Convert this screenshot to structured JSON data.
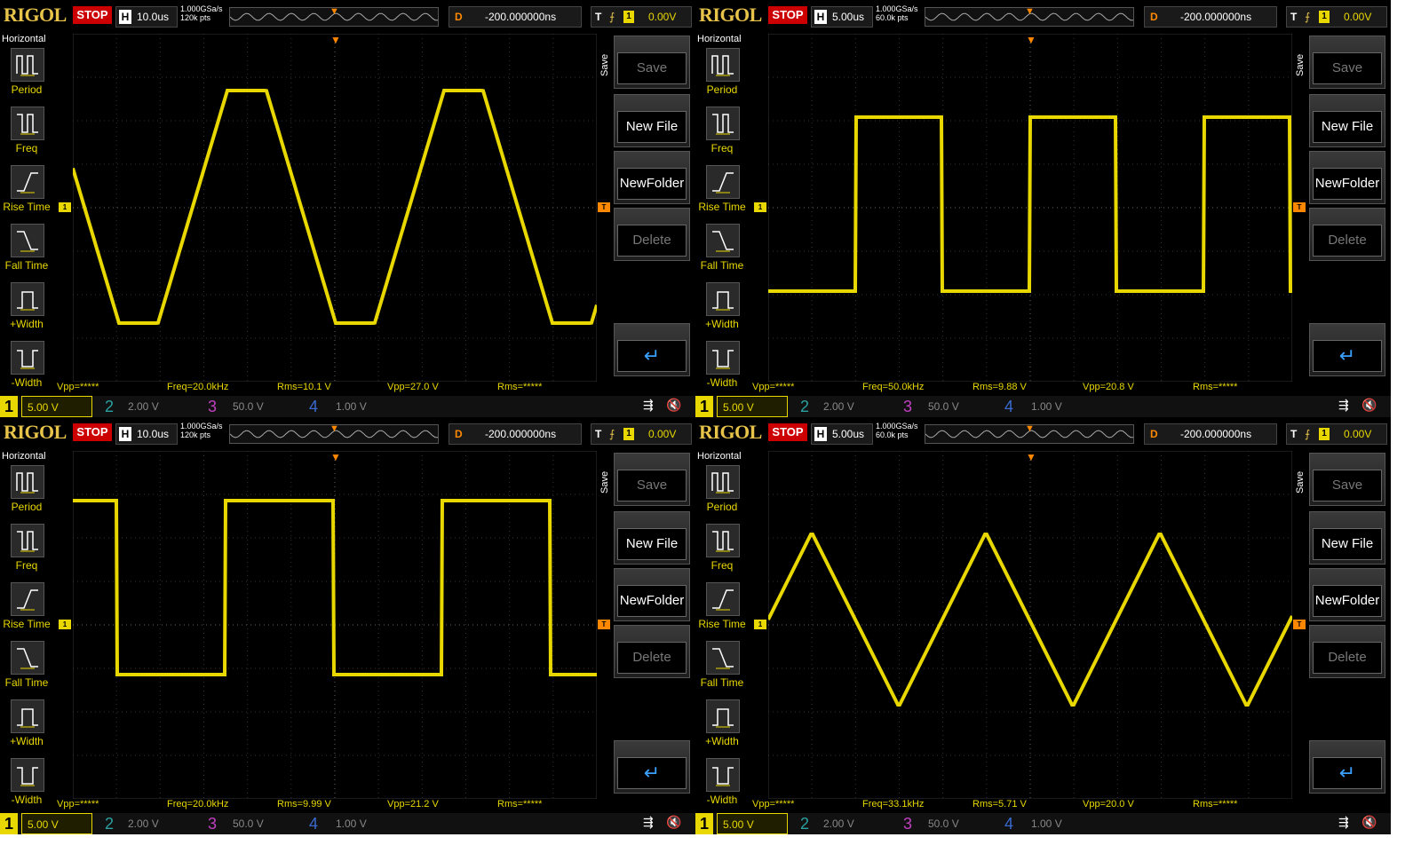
{
  "screens": [
    {
      "id": "top-left",
      "logo": "RIGOL",
      "stop": "STOP",
      "h_key": "H",
      "h_value": "10.0us",
      "sample_rate": "1.000GSa/s",
      "mem_depth": "120k pts",
      "d_key": "D",
      "d_value": "-200.000000ns",
      "t_key": "T",
      "trig_ch": "1",
      "trig_level": "0.00V",
      "left_title": "Horizontal",
      "left_items": [
        "Period",
        "Freq",
        "Rise Time",
        "Fall Time",
        "+Width",
        "-Width"
      ],
      "save_label": "Save",
      "buttons": [
        "Save",
        "New File",
        "NewFolder",
        "Delete"
      ],
      "meas": {
        "vpp": "Vpp=*****",
        "freq": "Freq=20.0kHz",
        "rms": "Rms=10.1 V",
        "vpp2": "Vpp=27.0 V",
        "rms2": "Rms=*****"
      },
      "ch1": "1",
      "ch1_scale": "5.00 V",
      "ch2": "2",
      "ch2_scale": "2.00 V",
      "ch3": "3",
      "ch3_scale": "50.0 V",
      "ch4": "4",
      "ch4_scale": "1.00 V",
      "wave": "trapezoid"
    },
    {
      "id": "top-right",
      "logo": "RIGOL",
      "stop": "STOP",
      "h_key": "H",
      "h_value": "5.00us",
      "sample_rate": "1.000GSa/s",
      "mem_depth": "60.0k pts",
      "d_key": "D",
      "d_value": "-200.000000ns",
      "t_key": "T",
      "trig_ch": "1",
      "trig_level": "0.00V",
      "left_title": "Horizontal",
      "left_items": [
        "Period",
        "Freq",
        "Rise Time",
        "Fall Time",
        "+Width",
        "-Width"
      ],
      "save_label": "Save",
      "buttons": [
        "Save",
        "New File",
        "NewFolder",
        "Delete"
      ],
      "meas": {
        "vpp": "Vpp=*****",
        "freq": "Freq=50.0kHz",
        "rms": "Rms=9.88 V",
        "vpp2": "Vpp=20.8 V",
        "rms2": "Rms=*****"
      },
      "ch1": "1",
      "ch1_scale": "5.00 V",
      "ch2": "2",
      "ch2_scale": "2.00 V",
      "ch3": "3",
      "ch3_scale": "50.0 V",
      "ch4": "4",
      "ch4_scale": "1.00 V",
      "wave": "square50"
    },
    {
      "id": "bottom-left",
      "logo": "RIGOL",
      "stop": "STOP",
      "h_key": "H",
      "h_value": "10.0us",
      "sample_rate": "1.000GSa/s",
      "mem_depth": "120k pts",
      "d_key": "D",
      "d_value": "-200.000000ns",
      "t_key": "T",
      "trig_ch": "1",
      "trig_level": "0.00V",
      "left_title": "Horizontal",
      "left_items": [
        "Period",
        "Freq",
        "Rise Time",
        "Fall Time",
        "+Width",
        "-Width"
      ],
      "save_label": "Save",
      "buttons": [
        "Save",
        "New File",
        "NewFolder",
        "Delete"
      ],
      "meas": {
        "vpp": "Vpp=*****",
        "freq": "Freq=20.0kHz",
        "rms": "Rms=9.99 V",
        "vpp2": "Vpp=21.2 V",
        "rms2": "Rms=*****"
      },
      "ch1": "1",
      "ch1_scale": "5.00 V",
      "ch2": "2",
      "ch2_scale": "2.00 V",
      "ch3": "3",
      "ch3_scale": "50.0 V",
      "ch4": "4",
      "ch4_scale": "1.00 V",
      "wave": "square20"
    },
    {
      "id": "bottom-right",
      "logo": "RIGOL",
      "stop": "STOP",
      "h_key": "H",
      "h_value": "5.00us",
      "sample_rate": "1.000GSa/s",
      "mem_depth": "60.0k pts",
      "d_key": "D",
      "d_value": "-200.000000ns",
      "t_key": "T",
      "trig_ch": "1",
      "trig_level": "0.00V",
      "left_title": "Horizontal",
      "left_items": [
        "Period",
        "Freq",
        "Rise Time",
        "Fall Time",
        "+Width",
        "-Width"
      ],
      "save_label": "Save",
      "buttons": [
        "Save",
        "New File",
        "NewFolder",
        "Delete"
      ],
      "meas": {
        "vpp": "Vpp=*****",
        "freq": "Freq=33.1kHz",
        "rms": "Rms=5.71 V",
        "vpp2": "Vpp=20.0 V",
        "rms2": "Rms=*****"
      },
      "ch1": "1",
      "ch1_scale": "5.00 V",
      "ch2": "2",
      "ch2_scale": "2.00 V",
      "ch3": "3",
      "ch3_scale": "50.0 V",
      "ch4": "4",
      "ch4_scale": "1.00 V",
      "wave": "triangle"
    }
  ],
  "colors": {
    "ch1": "#e8d800",
    "ch2": "#2aa0a0",
    "ch3": "#c040c0",
    "ch4": "#3a6ad0",
    "trigger": "#ff8800",
    "grid": "#444444"
  }
}
